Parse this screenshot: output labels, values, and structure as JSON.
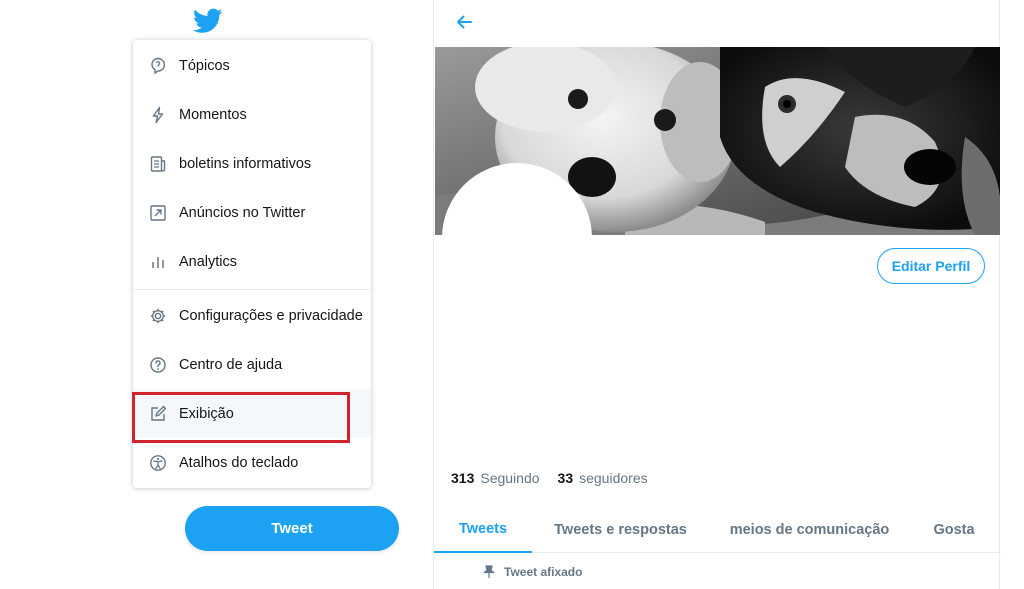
{
  "brand": {
    "logo_icon": "twitter-bird-icon",
    "color": "#1da1f2"
  },
  "menu": {
    "items": [
      {
        "label": "Tópicos",
        "icon": "topics-icon"
      },
      {
        "label": "Momentos",
        "icon": "lightning-icon"
      },
      {
        "label": "boletins informativos",
        "icon": "newsletter-icon"
      },
      {
        "label": "Anúncios no Twitter",
        "icon": "external-arrow-icon"
      },
      {
        "label": "Analytics",
        "icon": "bar-chart-icon"
      },
      {
        "label": "Configurações e privacidade",
        "icon": "gear-icon"
      },
      {
        "label": "Centro de ajuda",
        "icon": "help-icon"
      },
      {
        "label": "Exibição",
        "icon": "edit-display-icon"
      },
      {
        "label": "Atalhos do teclado",
        "icon": "accessibility-icon"
      }
    ],
    "highlighted_item": "Exibição",
    "highlight_color": "#d0232c"
  },
  "tweet_button": {
    "label": "Tweet"
  },
  "profile": {
    "edit_label": "Editar Perfil",
    "following_count": "313",
    "following_label": "Seguindo",
    "followers_count": "33",
    "followers_label": "seguidores"
  },
  "tabs": [
    {
      "label": "Tweets",
      "active": true
    },
    {
      "label": "Tweets e respostas",
      "active": false
    },
    {
      "label": "meios de comunicação",
      "active": false
    },
    {
      "label": "Gosta",
      "active": false
    }
  ],
  "pinned": {
    "label": "Tweet afixado"
  }
}
